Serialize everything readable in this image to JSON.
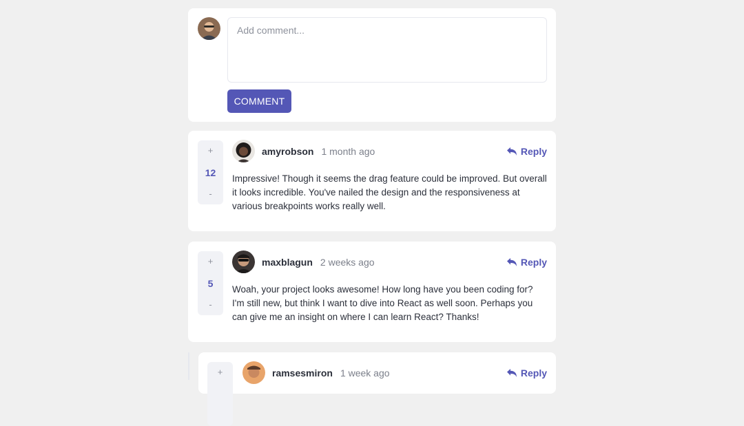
{
  "composer": {
    "placeholder": "Add comment...",
    "submit_label": "COMMENT",
    "avatar_icon": "user-avatar"
  },
  "comments": [
    {
      "user": "amyrobson",
      "time": "1 month ago",
      "score": "12",
      "upvote": "+",
      "downvote": "-",
      "reply_label": "Reply",
      "text": "Impressive! Though it seems the drag feature could be improved. But overall it looks incredible. You've nailed the design and the responsiveness at various breakpoints works really well."
    },
    {
      "user": "maxblagun",
      "time": "2 weeks ago",
      "score": "5",
      "upvote": "+",
      "downvote": "-",
      "reply_label": "Reply",
      "text": "Woah, your project looks awesome! How long have you been coding for? I'm still new, but think I want to dive into React as well soon. Perhaps you can give me an insight on where I can learn React? Thanks!"
    },
    {
      "user": "ramsesmiron",
      "time": "1 week ago",
      "upvote": "+",
      "reply_label": "Reply"
    }
  ],
  "colors": {
    "accent": "#5457b6",
    "background": "#f0f0f0",
    "card": "#ffffff",
    "vote_bg": "#f1f2f6"
  }
}
